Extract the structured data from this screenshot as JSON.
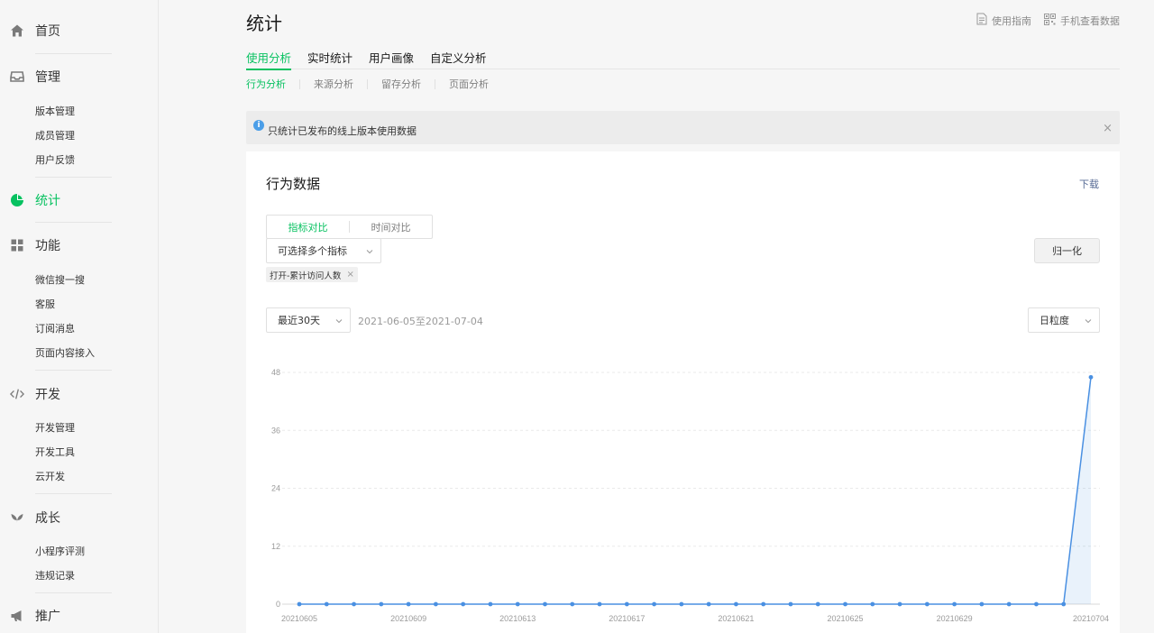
{
  "sidebar": {
    "groups": [
      {
        "label": "首页",
        "icon": "home-icon",
        "items": []
      },
      {
        "label": "管理",
        "icon": "inbox-icon",
        "items": [
          "版本管理",
          "成员管理",
          "用户反馈"
        ]
      },
      {
        "label": "统计",
        "icon": "pie-chart-icon",
        "items": [],
        "active": true
      },
      {
        "label": "功能",
        "icon": "grid-icon",
        "items": [
          "微信搜一搜",
          "客服",
          "订阅消息",
          "页面内容接入"
        ]
      },
      {
        "label": "开发",
        "icon": "code-icon",
        "items": [
          "开发管理",
          "开发工具",
          "云开发"
        ]
      },
      {
        "label": "成长",
        "icon": "sprout-icon",
        "items": [
          "小程序评测",
          "违规记录"
        ]
      },
      {
        "label": "推广",
        "icon": "megaphone-icon",
        "items": []
      }
    ]
  },
  "header": {
    "title": "统计",
    "links": [
      {
        "label": "使用指南",
        "icon": "document-icon"
      },
      {
        "label": "手机查看数据",
        "icon": "qr-icon"
      }
    ]
  },
  "tabs": [
    {
      "label": "使用分析",
      "active": true
    },
    {
      "label": "实时统计"
    },
    {
      "label": "用户画像"
    },
    {
      "label": "自定义分析"
    }
  ],
  "subtabs": [
    {
      "label": "行为分析",
      "active": true
    },
    {
      "label": "来源分析"
    },
    {
      "label": "留存分析"
    },
    {
      "label": "页面分析"
    }
  ],
  "notice": {
    "text": "只统计已发布的线上版本使用数据",
    "close": "×"
  },
  "card": {
    "title": "行为数据",
    "download": "下载",
    "segment": [
      "指标对比",
      "时间对比"
    ],
    "metric_select": "可选择多个指标",
    "normalize": "归一化",
    "tag": "打开-累计访问人数",
    "range_select": "最近30天",
    "date_range": "2021-06-05至2021-07-04",
    "granularity": "日粒度"
  },
  "colors": {
    "accent": "#07c160",
    "line": "#4a90e2",
    "link": "#576b95"
  },
  "chart_data": {
    "type": "line",
    "x": [
      "20210605",
      "20210606",
      "20210607",
      "20210608",
      "20210609",
      "20210610",
      "20210611",
      "20210612",
      "20210613",
      "20210614",
      "20210615",
      "20210616",
      "20210617",
      "20210618",
      "20210619",
      "20210620",
      "20210621",
      "20210622",
      "20210623",
      "20210624",
      "20210625",
      "20210626",
      "20210627",
      "20210628",
      "20210629",
      "20210630",
      "20210701",
      "20210702",
      "20210703",
      "20210704"
    ],
    "x_tick_labels": [
      "20210605",
      "20210609",
      "20210613",
      "20210617",
      "20210621",
      "20210625",
      "20210629",
      "20210704"
    ],
    "series": [
      {
        "values": [
          0,
          0,
          0,
          0,
          0,
          0,
          0,
          0,
          0,
          0,
          0,
          0,
          0,
          0,
          0,
          0,
          0,
          0,
          0,
          0,
          0,
          0,
          0,
          0,
          0,
          0,
          0,
          0,
          0,
          47
        ]
      }
    ],
    "y_ticks": [
      0,
      12,
      24,
      36,
      48
    ],
    "ylim": [
      0,
      48
    ],
    "grid": true,
    "area_fill": true
  }
}
